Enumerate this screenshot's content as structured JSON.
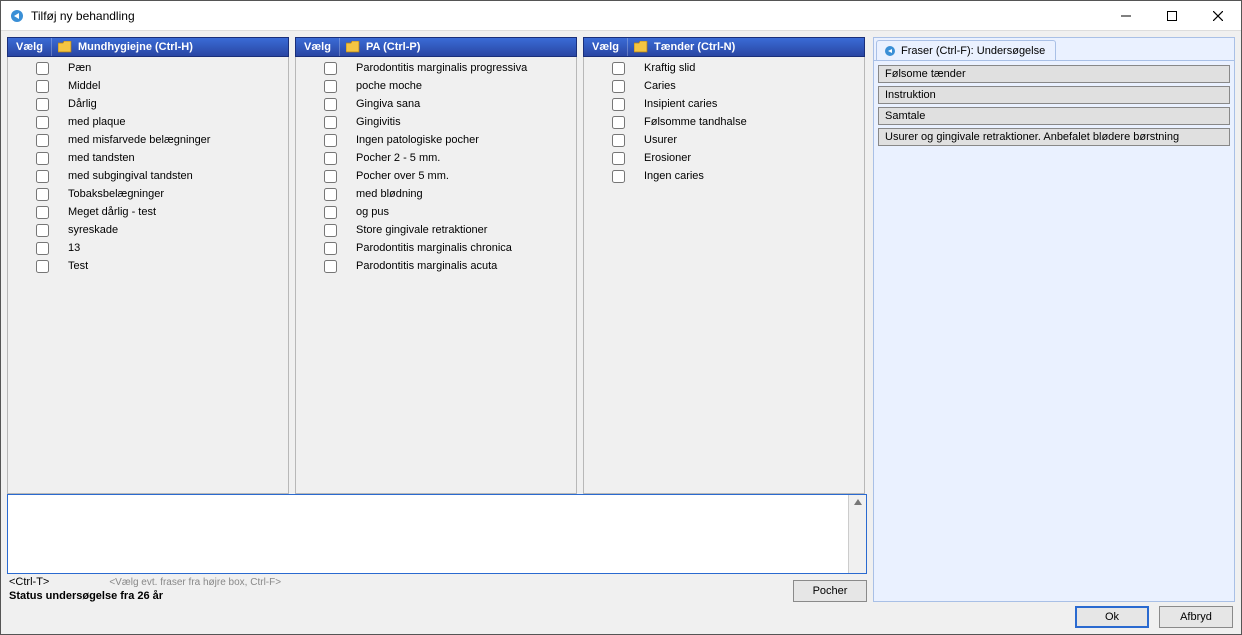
{
  "window": {
    "title": "Tilføj ny behandling"
  },
  "columns": {
    "select_label": "Vælg",
    "col1": {
      "header": "Mundhygiejne (Ctrl-H)",
      "items": [
        "Pæn",
        "Middel",
        "Dårlig",
        "med plaque",
        "med misfarvede belægninger",
        "med tandsten",
        "med subgingival tandsten",
        "Tobaksbelægninger",
        "Meget dårlig - test",
        "syreskade",
        "13",
        "Test"
      ]
    },
    "col2": {
      "header": "PA (Ctrl-P)",
      "items": [
        "Parodontitis marginalis progressiva",
        "poche moche",
        "Gingiva sana",
        "Gingivitis",
        "Ingen patologiske pocher",
        "Pocher 2 - 5 mm.",
        "Pocher over 5 mm.",
        "med blødning",
        "og pus",
        "Store gingivale retraktioner",
        "Parodontitis marginalis chronica",
        "Parodontitis marginalis acuta"
      ]
    },
    "col3": {
      "header": "Tænder (Ctrl-N)",
      "items": [
        "Kraftig slid",
        "Caries",
        "Insipient caries",
        "Følsomme tandhalse",
        "Usurer",
        "Erosioner",
        "Ingen caries"
      ]
    }
  },
  "fraser": {
    "tab_label": "Fraser (Ctrl-F): Undersøgelse",
    "items": [
      "Følsome tænder",
      "Instruktion",
      "Samtale",
      "Usurer og gingivale retraktioner. Anbefalet blødere børstning"
    ]
  },
  "notes": {
    "value": ""
  },
  "hints": {
    "ctrl_t": "<Ctrl-T>",
    "ctrl_f": "<Vælg evt. fraser fra højre box, Ctrl-F>",
    "status": "Status undersøgelse fra 26 år"
  },
  "buttons": {
    "pocher": "Pocher",
    "ok": "Ok",
    "afbryd": "Afbryd"
  }
}
